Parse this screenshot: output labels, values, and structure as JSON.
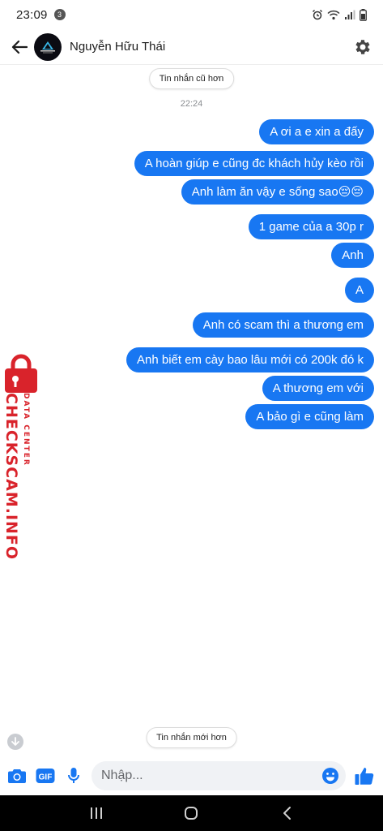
{
  "status": {
    "time": "23:09",
    "notification_count": "3"
  },
  "header": {
    "contact_name": "Nguyễn Hữu Thái"
  },
  "pills": {
    "older": "Tin nhắn cũ hơn",
    "newer": "Tin nhắn mới hơn"
  },
  "timestamp": "22:24",
  "messages": [
    "A ơi a e xin a đấy",
    "A hoàn giúp e cũng đc khách hủy kèo rồi",
    "Anh làm ăn vậy e sống sao😔😔",
    "1 game của a 30p r",
    "Anh",
    "A",
    "Anh có scam thì a thương em",
    "Anh biết em cày bao lâu mới có 200k đó k",
    "A thương em với",
    "A bảo gì e cũng làm"
  ],
  "watermark": {
    "main": "CHECKSCAM.INFO",
    "sub": "DATA CENTER"
  },
  "composer": {
    "placeholder": "Nhập...",
    "gif_label": "GIF"
  },
  "colors": {
    "bubble": "#1877f2",
    "accent": "#1877f2",
    "watermark": "#d9232b"
  },
  "icons": [
    "back-arrow-icon",
    "gear-icon",
    "camera-icon",
    "gif-icon",
    "microphone-icon",
    "emoji-icon",
    "thumbs-up-icon",
    "arrow-down-icon",
    "recent-apps-icon",
    "home-icon",
    "nav-back-icon"
  ]
}
